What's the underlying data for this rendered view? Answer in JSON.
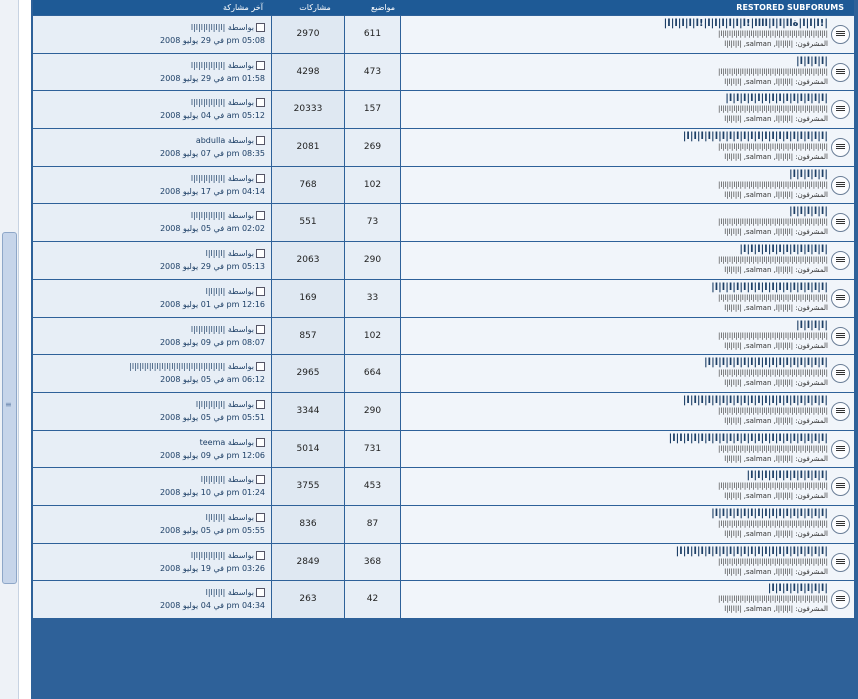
{
  "header": {
    "title": "RESTORED SUBFORUMS",
    "topics_label": "مواضيع",
    "posts_label": "مشاركات",
    "last_label": "آخر مشاركة"
  },
  "forums": [
    {
      "title": "|!ا|ا|ا|ةاا|ا|ا|اااا|!ا|ا|ا|ا|ا|ا|!ا|ا|ا|ا|ا|",
      "desc": "|ا|ا|ا|ا|ا|ا|ا|ا|ا|ا|ا|ا|ا|ا|ا|ا|ا|ا|ا|ا|ا|ا|ا|ا|ا|",
      "mods": "المشرفون: |ا|ا|ا|ا, salman, |ا|ا|ا|ا",
      "topics": "611",
      "posts": "2970",
      "last_by": "بواسطة |ا|ا|ا|ا|ا|ا|ا",
      "last_date": "في 29 يوليو 2008 pm 05:08"
    },
    {
      "title": "|ا|ا|ا|ا|",
      "desc": "|ا|ا|ا|ا|ا|ا|ا|ا|ا|ا|ا|ا|ا|ا|ا|ا|ا|ا|ا|ا|ا|ا|ا|ا|ا|",
      "mods": "المشرفون: |ا|ا|ا|ا, salman, |ا|ا|ا|ا",
      "topics": "473",
      "posts": "4298",
      "last_by": "بواسطة |ا|ا|ا|ا|ا|ا|ا",
      "last_date": "في 29 يوليو 2008 am 01:58"
    },
    {
      "title": "|ا|ا|ا|ا|ا|ا|ا|ا|ا|ا|ا|ا|ا|ا|",
      "desc": "|ا|ا|ا|ا|ا|ا|ا|ا|ا|ا|ا|ا|ا|ا|ا|ا|ا|ا|ا|ا|ا|ا|ا|ا|ا|",
      "mods": "المشرفون: |ا|ا|ا|ا, salman, |ا|ا|ا|ا",
      "topics": "157",
      "posts": "20333",
      "last_by": "بواسطة |ا|ا|ا|ا|ا|ا|ا",
      "last_date": "في 04 يوليو 2008 am 05:12"
    },
    {
      "title": "|ا|ا|ا|ا|ا|ا|ا|ا|ا|ا|ا|ا|ا|ا|ا|ا|ا|ا|ا|ا|",
      "desc": "|ا|ا|ا|ا|ا|ا|ا|ا|ا|ا|ا|ا|ا|ا|ا|ا|ا|ا|ا|ا|ا|ا|ا|ا|ا|",
      "mods": "المشرفون: |ا|ا|ا|ا, salman, |ا|ا|ا|ا",
      "topics": "269",
      "posts": "2081",
      "last_by": "بواسطة abdulla",
      "last_date": "في 07 يوليو 2008 pm 08:35"
    },
    {
      "title": "|ا|ا|ا|ا|ا|",
      "desc": "|ا|ا|ا|ا|ا|ا|ا|ا|ا|ا|ا|ا|ا|ا|ا|ا|ا|ا|ا|ا|ا|ا|ا|ا|ا|",
      "mods": "المشرفون: |ا|ا|ا|ا, salman, |ا|ا|ا|ا",
      "topics": "102",
      "posts": "768",
      "last_by": "بواسطة |ا|ا|ا|ا|ا|ا|ا",
      "last_date": "في 17 يوليو 2008 pm 04:14"
    },
    {
      "title": "|ا|ا|ا|ا|ا|",
      "desc": "|ا|ا|ا|ا|ا|ا|ا|ا|ا|ا|ا|ا|ا|ا|ا|ا|ا|ا|ا|ا|ا|ا|ا|ا|ا|",
      "mods": "المشرفون: |ا|ا|ا|ا, salman, |ا|ا|ا|ا",
      "topics": "73",
      "posts": "551",
      "last_by": "بواسطة |ا|ا|ا|ا|ا|ا|ا",
      "last_date": "في 05 يوليو 2008 am 02:02"
    },
    {
      "title": "|ا|ا|ا|ا|ا|ا|ا|ا|ا|ا|ا|ا|",
      "desc": "|ا|ا|ا|ا|ا|ا|ا|ا|ا|ا|ا|ا|ا|ا|ا|ا|ا|ا|ا|ا|ا|ا|ا|ا|ا|",
      "mods": "المشرفون: |ا|ا|ا|ا, salman, |ا|ا|ا|ا",
      "topics": "290",
      "posts": "2063",
      "last_by": "بواسطة |ا|ا|ا|ا",
      "last_date": "في 29 يوليو 2008 pm 05:13"
    },
    {
      "title": "|ا|ا|ا|ا|ا|ا|ا|ا|ا|ا|ا|ا|ا|ا|ا|ا|",
      "desc": "|ا|ا|ا|ا|ا|ا|ا|ا|ا|ا|ا|ا|ا|ا|ا|ا|ا|ا|ا|ا|ا|ا|ا|ا|ا|",
      "mods": "المشرفون: |ا|ا|ا|ا, salman, |ا|ا|ا|ا",
      "topics": "33",
      "posts": "169",
      "last_by": "بواسطة |ا|ا|ا|ا",
      "last_date": "في 01 يوليو 2008 pm 12:16"
    },
    {
      "title": "|ا|ا|ا|ا|",
      "desc": "|ا|ا|ا|ا|ا|ا|ا|ا|ا|ا|ا|ا|ا|ا|ا|ا|ا|ا|ا|ا|ا|ا|ا|ا|ا|",
      "mods": "المشرفون: |ا|ا|ا|ا, salman, |ا|ا|ا|ا",
      "topics": "102",
      "posts": "857",
      "last_by": "بواسطة |ا|ا|ا|ا|ا|ا|ا",
      "last_date": "في 09 يوليو 2008 pm 08:07"
    },
    {
      "title": "|ا|ا|ا|ا|ا|ا|ا|ا|ا|ا|ا|ا|ا|ا|ا|ا|ا|",
      "desc": "|ا|ا|ا|ا|ا|ا|ا|ا|ا|ا|ا|ا|ا|ا|ا|ا|ا|ا|ا|ا|ا|ا|ا|ا|ا|",
      "mods": "المشرفون: |ا|ا|ا|ا, salman, |ا|ا|ا|ا",
      "topics": "664",
      "posts": "2965",
      "last_by": "بواسطة |ا|ا|ا|ا|ا|ا|ا|ا|ا|ا|ا|ا|ا|ا|ا|ا|ا|ا|ا|",
      "last_date": "في 05 يوليو 2008 am 06:12"
    },
    {
      "title": "|ا|ا|ا|ا|ا|ا|ا|ا|ا|ا|ا|ا|ا|ا|ا|ا|ا|ا|ا|ا|",
      "desc": "|ا|ا|ا|ا|ا|ا|ا|ا|ا|ا|ا|ا|ا|ا|ا|ا|ا|ا|ا|ا|ا|ا|ا|ا|ا|",
      "mods": "المشرفون: |ا|ا|ا|ا, salman, |ا|ا|ا|ا",
      "topics": "290",
      "posts": "3344",
      "last_by": "بواسطة |ا|ا|ا|ا|ا|ا",
      "last_date": "في 05 يوليو 2008 pm 05:51"
    },
    {
      "title": "|ا|ا|ا|ا|ا|ا|ا|ا|ا|ا|ا|ا|ا|ا|ا|ا|ا|ا|ا|ا|ا|ا|",
      "desc": "|ا|ا|ا|ا|ا|ا|ا|ا|ا|ا|ا|ا|ا|ا|ا|ا|ا|ا|ا|ا|ا|ا|ا|ا|ا|",
      "mods": "المشرفون: |ا|ا|ا|ا, salman, |ا|ا|ا|ا",
      "topics": "731",
      "posts": "5014",
      "last_by": "بواسطة teema",
      "last_date": "في 09 يوليو 2008 pm 12:06"
    },
    {
      "title": "|ا|ا|ا|ا|ا|ا|ا|ا|ا|ا|ا|",
      "desc": "|ا|ا|ا|ا|ا|ا|ا|ا|ا|ا|ا|ا|ا|ا|ا|ا|ا|ا|ا|ا|ا|ا|ا|ا|ا|",
      "mods": "المشرفون: |ا|ا|ا|ا, salman, |ا|ا|ا|ا",
      "topics": "453",
      "posts": "3755",
      "last_by": "بواسطة |ا|ا|ا|ا|ا",
      "last_date": "في 10 يوليو 2008 pm 01:24"
    },
    {
      "title": "|ا|ا|ا|ا|ا|ا|ا|ا|ا|ا|ا|ا|ا|ا|ا|ا|",
      "desc": "|ا|ا|ا|ا|ا|ا|ا|ا|ا|ا|ا|ا|ا|ا|ا|ا|ا|ا|ا|ا|ا|ا|ا|ا|ا|",
      "mods": "المشرفون: |ا|ا|ا|ا, salman, |ا|ا|ا|ا",
      "topics": "87",
      "posts": "836",
      "last_by": "بواسطة |ا|ا|ا|ا",
      "last_date": "في 05 يوليو 2008 pm 05:55"
    },
    {
      "title": "|ا|ا|ا|ا|ا|ا|ا|ا|ا|ا|ا|ا|ا|ا|ا|ا|ا|ا|ا|ا|ا|",
      "desc": "|ا|ا|ا|ا|ا|ا|ا|ا|ا|ا|ا|ا|ا|ا|ا|ا|ا|ا|ا|ا|ا|ا|ا|ا|ا|",
      "mods": "المشرفون: |ا|ا|ا|ا, salman, |ا|ا|ا|ا",
      "topics": "368",
      "posts": "2849",
      "last_by": "بواسطة |ا|ا|ا|ا|ا|ا|ا",
      "last_date": "في 19 يوليو 2008 pm 03:26"
    },
    {
      "title": "|ا|ا|ا|ا|ا|ا|ا|ا|",
      "desc": "|ا|ا|ا|ا|ا|ا|ا|ا|ا|ا|ا|ا|ا|ا|ا|ا|ا|ا|ا|ا|ا|ا|ا|ا|ا|",
      "mods": "المشرفون: |ا|ا|ا|ا, salman, |ا|ا|ا|ا",
      "topics": "42",
      "posts": "263",
      "last_by": "بواسطة |ا|ا|ا|ا",
      "last_date": "في 04 يوليو 2008 pm 04:34"
    }
  ]
}
